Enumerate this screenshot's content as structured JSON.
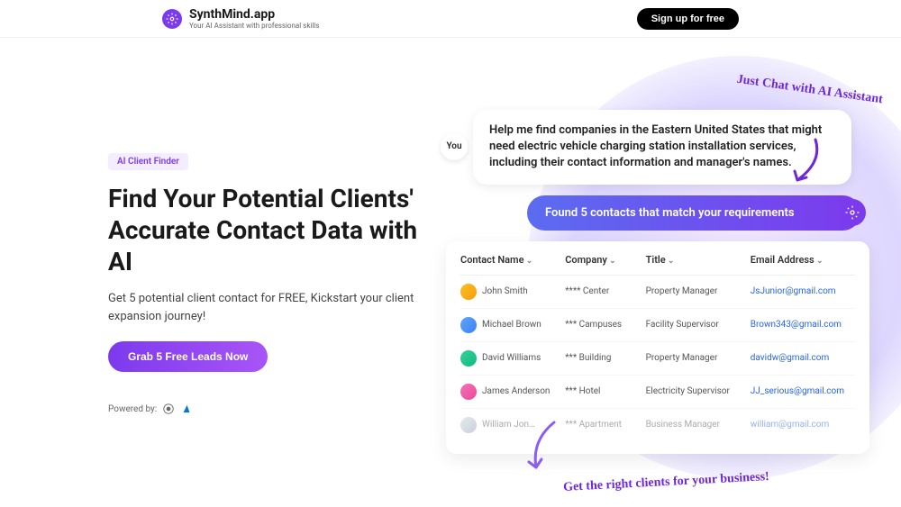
{
  "header": {
    "brand": "SynthMind.app",
    "tagline": "Your AI Assistant with professional skills",
    "signup_label": "Sign up for free"
  },
  "hero": {
    "badge": "AI Client Finder",
    "heading": "Find Your Potential Clients' Accurate Contact Data with AI",
    "subhead": "Get 5 potential client contact for FREE, Kickstart your client expansion journey!",
    "cta_label": "Grab 5 Free Leads Now",
    "powered_label": "Powered by:"
  },
  "chat": {
    "you_label": "You",
    "user_message": "Help me find companies in the Eastern United States that might need electric vehicle charging station installation services, including their contact information and manager's names.",
    "response": "Found 5 contacts that match your requirements"
  },
  "annotations": {
    "top": "Just Chat with AI Assistant",
    "bottom": "Get the right clients for your business!"
  },
  "contacts": {
    "columns": [
      "Contact Name",
      "Company",
      "Title",
      "Email Address"
    ],
    "rows": [
      {
        "name": "John Smith",
        "company": "**** Center",
        "title": "Property Manager",
        "email": "JsJunior@gmail.com"
      },
      {
        "name": "Michael Brown",
        "company": "*** Campuses",
        "title": "Facility Supervisor",
        "email": "Brown343@gmail.com"
      },
      {
        "name": "David Williams",
        "company": "*** Building",
        "title": "Property Manager",
        "email": "davidw@gmail.com"
      },
      {
        "name": "James Anderson",
        "company": "*** Hotel",
        "title": "Electricity Supervisor",
        "email": "JJ_serious@gmail.com"
      },
      {
        "name": "William Jon…",
        "company": "*** Apartment",
        "title": "Business Manager",
        "email": "william@gmail.com"
      }
    ]
  }
}
